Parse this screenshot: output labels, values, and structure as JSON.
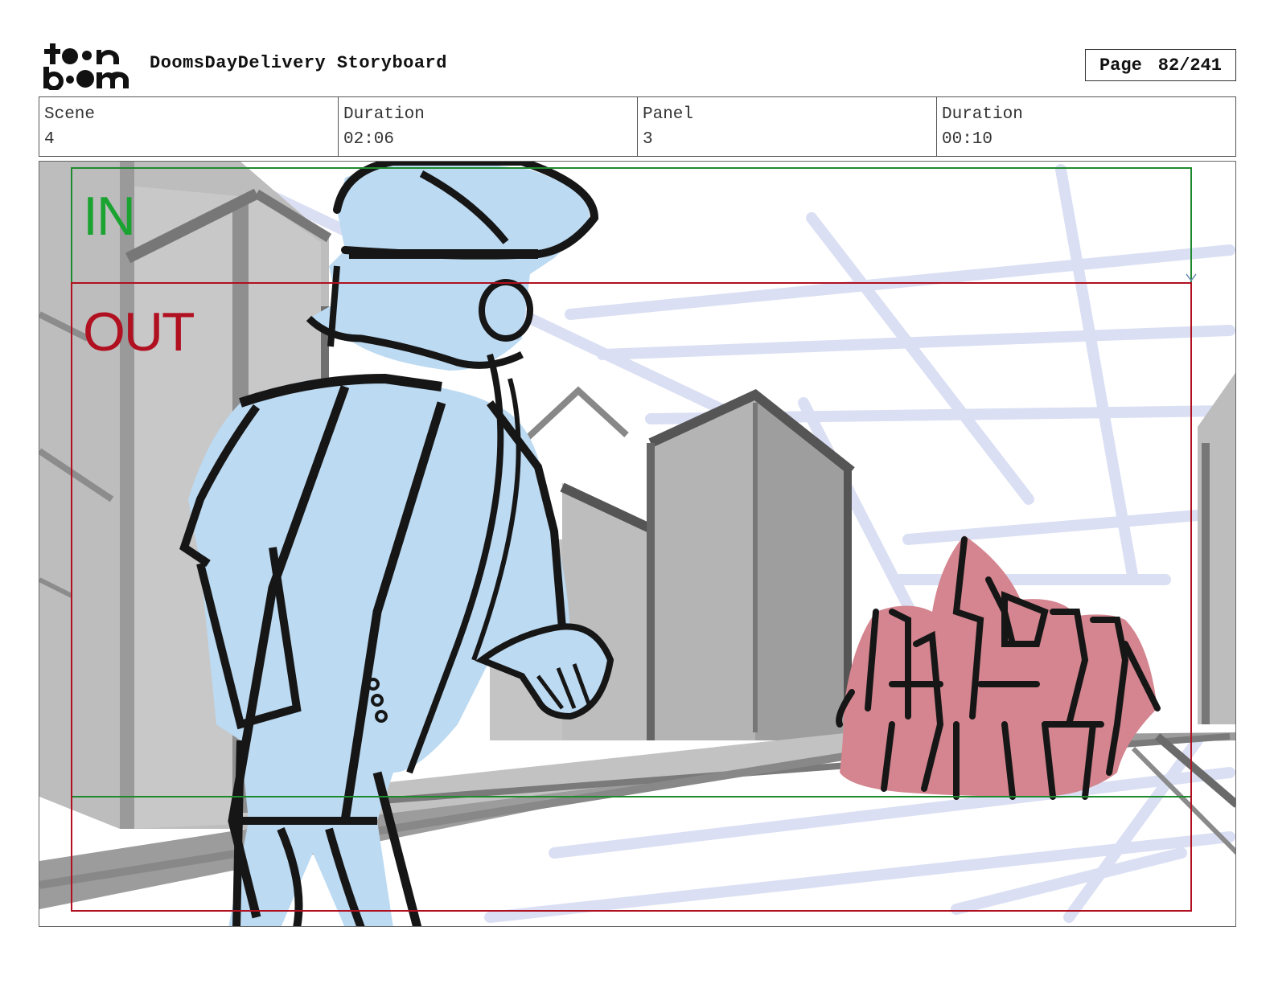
{
  "header": {
    "logo_text": "toon boom",
    "project_title": "DoomsDayDelivery Storyboard",
    "page_label": "Page",
    "page_value": "82/241"
  },
  "info": {
    "scene_label": "Scene",
    "scene_value": "4",
    "scene_duration_label": "Duration",
    "scene_duration_value": "02:06",
    "panel_label": "Panel",
    "panel_value": "3",
    "panel_duration_label": "Duration",
    "panel_duration_value": "00:10"
  },
  "panel": {
    "in_label": "IN",
    "out_label": "OUT",
    "colors": {
      "in_frame": "#1e8a2e",
      "out_frame": "#b01020",
      "character": "#bcdaf2",
      "crowd": "#d4858f",
      "buildings": "#b9b9b9",
      "guides": "#d7dcf2",
      "ink": "#161616"
    }
  }
}
